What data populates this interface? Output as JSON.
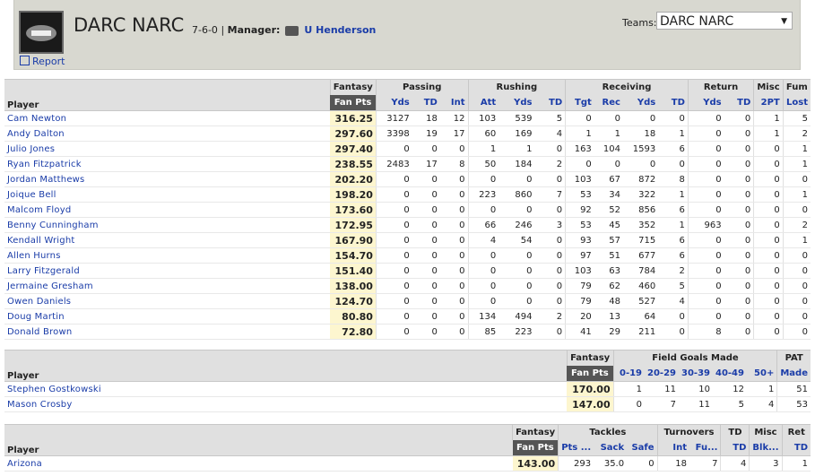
{
  "header": {
    "team_name": "DARC NARC",
    "record": "7-6-0",
    "manager_label": "Manager:",
    "manager_name": "U Henderson",
    "report_label": "Report",
    "teams_label": "Teams:",
    "teams_selected": "DARC NARC"
  },
  "offense": {
    "groups": [
      "Fantasy",
      "Passing",
      "Rushing",
      "Receiving",
      "Return",
      "Misc",
      "Fum"
    ],
    "player_header": "Player",
    "columns": [
      "Fan Pts",
      "Yds",
      "TD",
      "Int",
      "Att",
      "Yds",
      "TD",
      "Tgt",
      "Rec",
      "Yds",
      "TD",
      "Yds",
      "TD",
      "2PT",
      "Lost"
    ],
    "rows": [
      {
        "name": "Cam Newton",
        "fpts": "316.25",
        "stats": [
          "3127",
          "18",
          "12",
          "103",
          "539",
          "5",
          "0",
          "0",
          "0",
          "0",
          "0",
          "0",
          "1",
          "5"
        ]
      },
      {
        "name": "Andy Dalton",
        "fpts": "297.60",
        "stats": [
          "3398",
          "19",
          "17",
          "60",
          "169",
          "4",
          "1",
          "1",
          "18",
          "1",
          "0",
          "0",
          "1",
          "2"
        ]
      },
      {
        "name": "Julio Jones",
        "fpts": "297.40",
        "stats": [
          "0",
          "0",
          "0",
          "1",
          "1",
          "0",
          "163",
          "104",
          "1593",
          "6",
          "0",
          "0",
          "0",
          "1"
        ]
      },
      {
        "name": "Ryan Fitzpatrick",
        "fpts": "238.55",
        "stats": [
          "2483",
          "17",
          "8",
          "50",
          "184",
          "2",
          "0",
          "0",
          "0",
          "0",
          "0",
          "0",
          "0",
          "1"
        ]
      },
      {
        "name": "Jordan Matthews",
        "fpts": "202.20",
        "stats": [
          "0",
          "0",
          "0",
          "0",
          "0",
          "0",
          "103",
          "67",
          "872",
          "8",
          "0",
          "0",
          "0",
          "0"
        ]
      },
      {
        "name": "Joique Bell",
        "fpts": "198.20",
        "stats": [
          "0",
          "0",
          "0",
          "223",
          "860",
          "7",
          "53",
          "34",
          "322",
          "1",
          "0",
          "0",
          "0",
          "1"
        ]
      },
      {
        "name": "Malcom Floyd",
        "fpts": "173.60",
        "stats": [
          "0",
          "0",
          "0",
          "0",
          "0",
          "0",
          "92",
          "52",
          "856",
          "6",
          "0",
          "0",
          "0",
          "0"
        ]
      },
      {
        "name": "Benny Cunningham",
        "fpts": "172.95",
        "stats": [
          "0",
          "0",
          "0",
          "66",
          "246",
          "3",
          "53",
          "45",
          "352",
          "1",
          "963",
          "0",
          "0",
          "2"
        ]
      },
      {
        "name": "Kendall Wright",
        "fpts": "167.90",
        "stats": [
          "0",
          "0",
          "0",
          "4",
          "54",
          "0",
          "93",
          "57",
          "715",
          "6",
          "0",
          "0",
          "0",
          "1"
        ]
      },
      {
        "name": "Allen Hurns",
        "fpts": "154.70",
        "stats": [
          "0",
          "0",
          "0",
          "0",
          "0",
          "0",
          "97",
          "51",
          "677",
          "6",
          "0",
          "0",
          "0",
          "0"
        ]
      },
      {
        "name": "Larry Fitzgerald",
        "fpts": "151.40",
        "stats": [
          "0",
          "0",
          "0",
          "0",
          "0",
          "0",
          "103",
          "63",
          "784",
          "2",
          "0",
          "0",
          "0",
          "0"
        ]
      },
      {
        "name": "Jermaine Gresham",
        "fpts": "138.00",
        "stats": [
          "0",
          "0",
          "0",
          "0",
          "0",
          "0",
          "79",
          "62",
          "460",
          "5",
          "0",
          "0",
          "0",
          "0"
        ]
      },
      {
        "name": "Owen Daniels",
        "fpts": "124.70",
        "stats": [
          "0",
          "0",
          "0",
          "0",
          "0",
          "0",
          "79",
          "48",
          "527",
          "4",
          "0",
          "0",
          "0",
          "0"
        ]
      },
      {
        "name": "Doug Martin",
        "fpts": "80.80",
        "stats": [
          "0",
          "0",
          "0",
          "134",
          "494",
          "2",
          "20",
          "13",
          "64",
          "0",
          "0",
          "0",
          "0",
          "0"
        ]
      },
      {
        "name": "Donald Brown",
        "fpts": "72.80",
        "stats": [
          "0",
          "0",
          "0",
          "85",
          "223",
          "0",
          "41",
          "29",
          "211",
          "0",
          "8",
          "0",
          "0",
          "0"
        ]
      }
    ]
  },
  "kickers": {
    "groups": [
      "Fantasy",
      "Field Goals Made",
      "PAT"
    ],
    "player_header": "Player",
    "columns": [
      "Fan Pts",
      "0-19",
      "20-29",
      "30-39",
      "40-49",
      "50+",
      "Made"
    ],
    "rows": [
      {
        "name": "Stephen Gostkowski",
        "fpts": "170.00",
        "stats": [
          "1",
          "11",
          "10",
          "12",
          "1",
          "51"
        ]
      },
      {
        "name": "Mason Crosby",
        "fpts": "147.00",
        "stats": [
          "0",
          "7",
          "11",
          "5",
          "4",
          "53"
        ]
      }
    ]
  },
  "defense": {
    "groups": [
      "Fantasy",
      "Tackles",
      "Turnovers",
      "TD",
      "Misc",
      "Ret"
    ],
    "player_header": "Player",
    "columns": [
      "Fan Pts",
      "Pts ...",
      "Sack",
      "Safe",
      "Int",
      "Fu...",
      "TD",
      "Blk...",
      "TD"
    ],
    "rows": [
      {
        "name": "Arizona",
        "fpts": "143.00",
        "stats": [
          "293",
          "35.0",
          "0",
          "18",
          "7",
          "4",
          "3",
          "1"
        ]
      }
    ]
  }
}
